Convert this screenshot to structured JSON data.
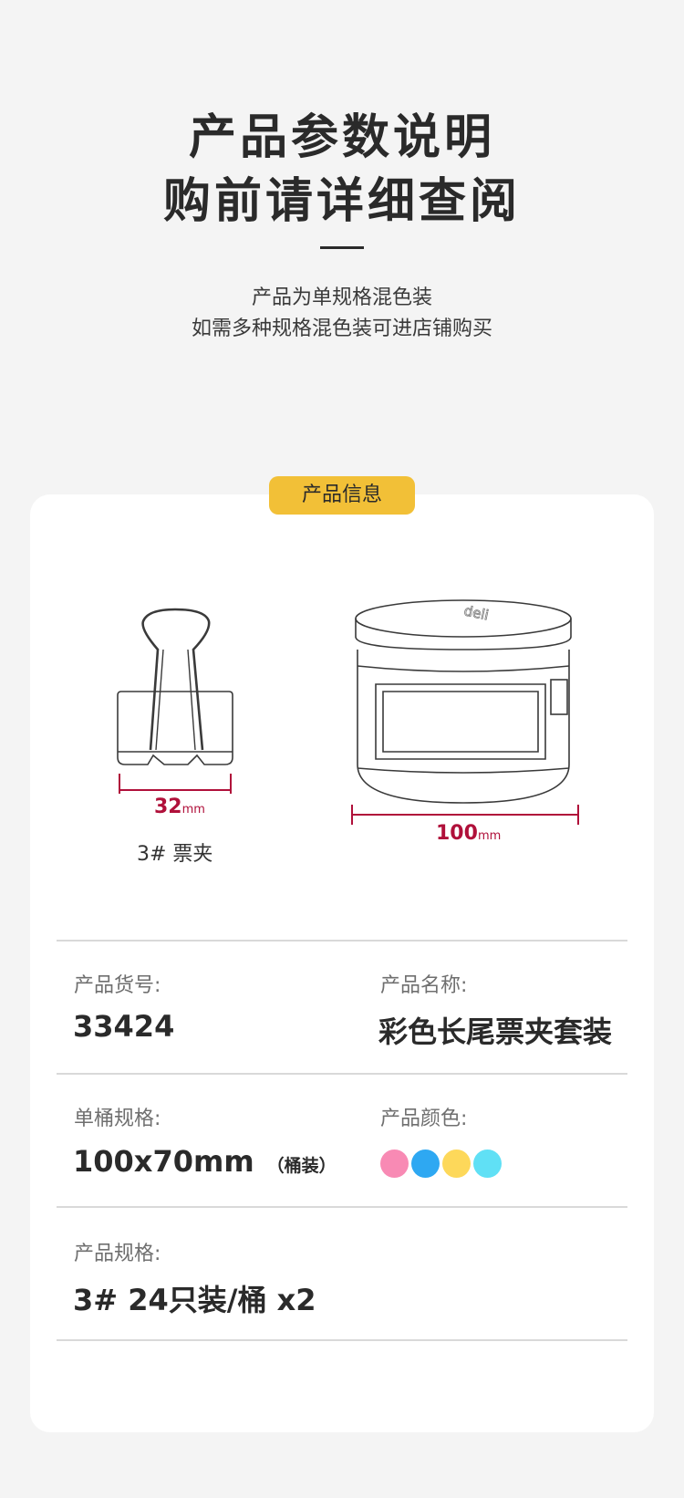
{
  "header": {
    "title_line1": "产品参数说明",
    "title_line2": "购前请详细查阅",
    "subtitle_line1": "产品为单规格混色装",
    "subtitle_line2": "如需多种规格混色装可进店铺购买"
  },
  "badge": {
    "label": "产品信息"
  },
  "illustration": {
    "clip_width_value": "32",
    "clip_width_unit": "mm",
    "clip_name": "3# 票夹",
    "bucket_width_value": "100",
    "bucket_width_unit": "mm",
    "bucket_logo": "deli"
  },
  "specs": {
    "item_no_label": "产品货号:",
    "item_no_value": "33424",
    "name_label": "产品名称:",
    "name_value": "彩色长尾票夹套装",
    "bucket_spec_label": "单桶规格:",
    "bucket_spec_value": "100x70mm",
    "bucket_spec_note": "（桶装）",
    "color_label": "产品颜色:",
    "colors": [
      "#f88ab4",
      "#2ea8f2",
      "#fdd85a",
      "#60e0f5"
    ],
    "product_spec_label": "产品规格:",
    "product_spec_value": "3#  24只装/桶 x2"
  },
  "theme": {
    "accent": "#f2c037",
    "dimension_color": "#b0103a"
  }
}
